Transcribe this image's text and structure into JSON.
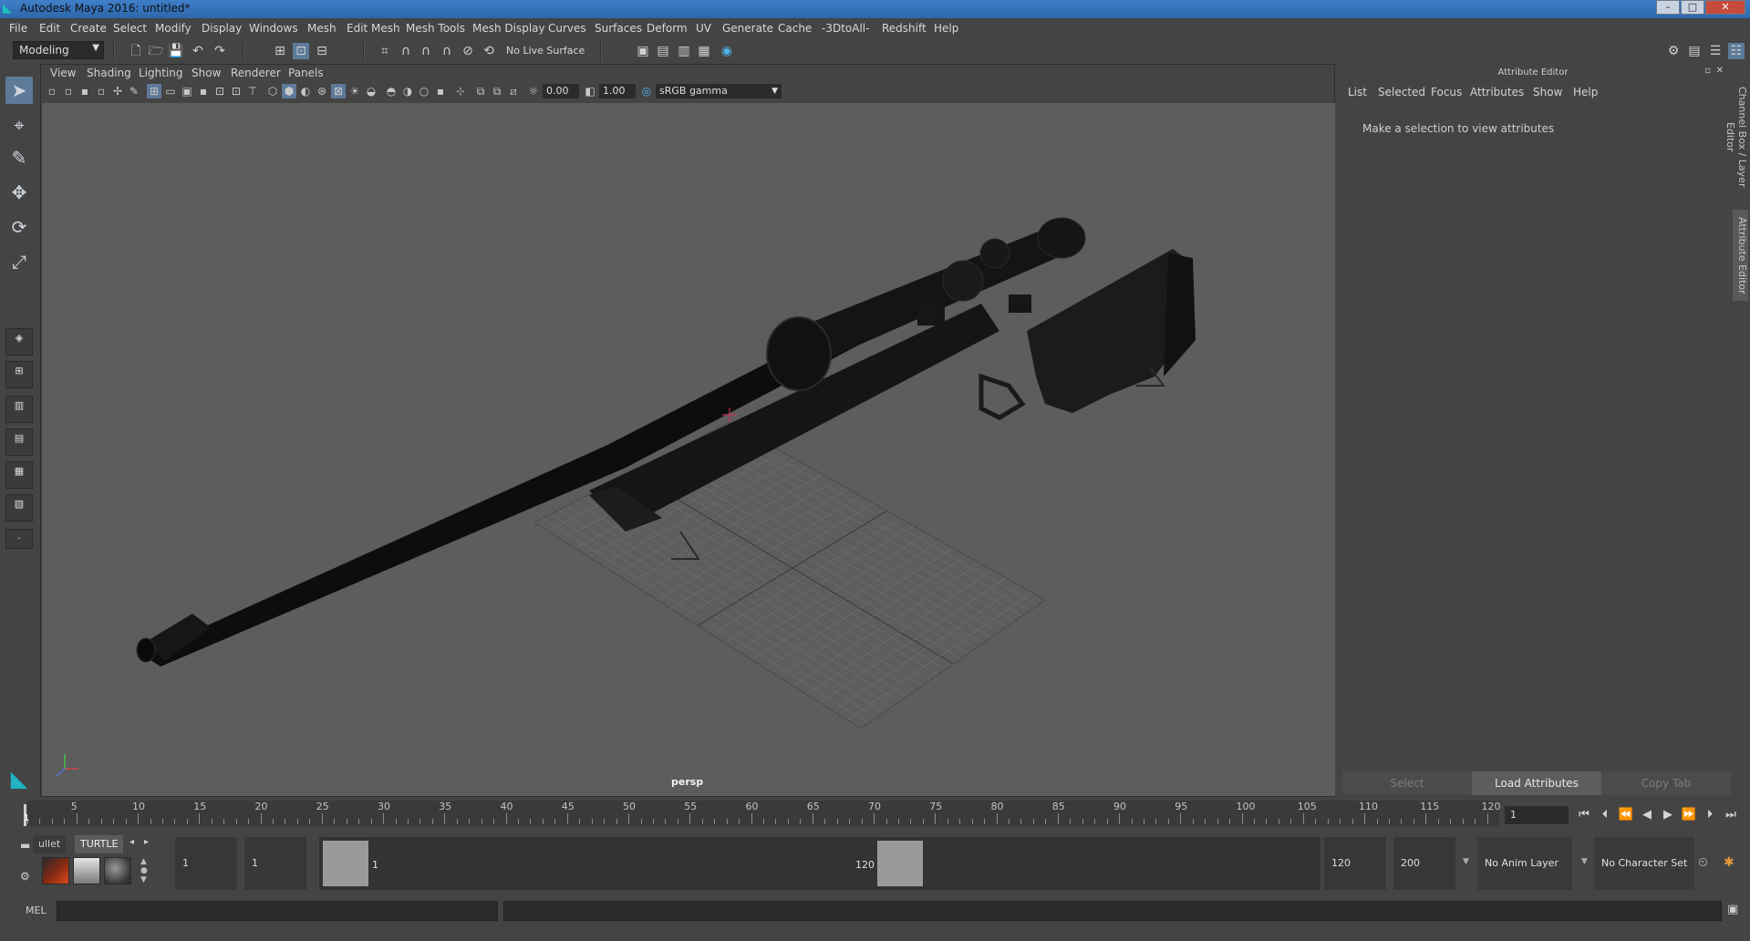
{
  "window": {
    "title": "Autodesk Maya 2016: untitled*"
  },
  "menubar": [
    "File",
    "Edit",
    "Create",
    "Select",
    "Modify",
    "Display",
    "Windows",
    "Mesh",
    "Edit Mesh",
    "Mesh Tools",
    "Mesh Display",
    "Curves",
    "Surfaces",
    "Deform",
    "UV",
    "Generate",
    "Cache",
    "-3DtoAll-",
    "Redshift",
    "Help"
  ],
  "toolbar": {
    "menuset": "Modeling",
    "live_surface": "No Live Surface"
  },
  "viewport": {
    "menus": [
      "View",
      "Shading",
      "Lighting",
      "Show",
      "Renderer",
      "Panels"
    ],
    "exposure": "0.00",
    "gamma": "1.00",
    "colorspace": "sRGB gamma",
    "camera_label": "persp"
  },
  "attribute_editor": {
    "title": "Attribute Editor",
    "menus": [
      "List",
      "Selected",
      "Focus",
      "Attributes",
      "Show",
      "Help"
    ],
    "message": "Make a selection to view attributes",
    "buttons": {
      "select": "Select",
      "load": "Load Attributes",
      "copy": "Copy Tab"
    },
    "side_tabs": [
      "Channel Box / Layer Editor",
      "Attribute Editor"
    ]
  },
  "timeline": {
    "ticks": [
      "5",
      "10",
      "15",
      "20",
      "25",
      "30",
      "35",
      "40",
      "45",
      "50",
      "55",
      "60",
      "65",
      "70",
      "75",
      "80",
      "85",
      "90",
      "95",
      "100",
      "105",
      "110",
      "115",
      "120"
    ],
    "current_frame": "1",
    "current_marker": "1"
  },
  "shelf": {
    "tabs": [
      "ullet",
      "TURTLE"
    ]
  },
  "range": {
    "start_time": "1",
    "playback_start": "1",
    "slider_start": "1",
    "slider_end": "120",
    "playback_end": "120",
    "end_time": "200",
    "anim_layer": "No Anim Layer",
    "character_set": "No Character Set"
  },
  "command_line": {
    "mode": "MEL"
  }
}
